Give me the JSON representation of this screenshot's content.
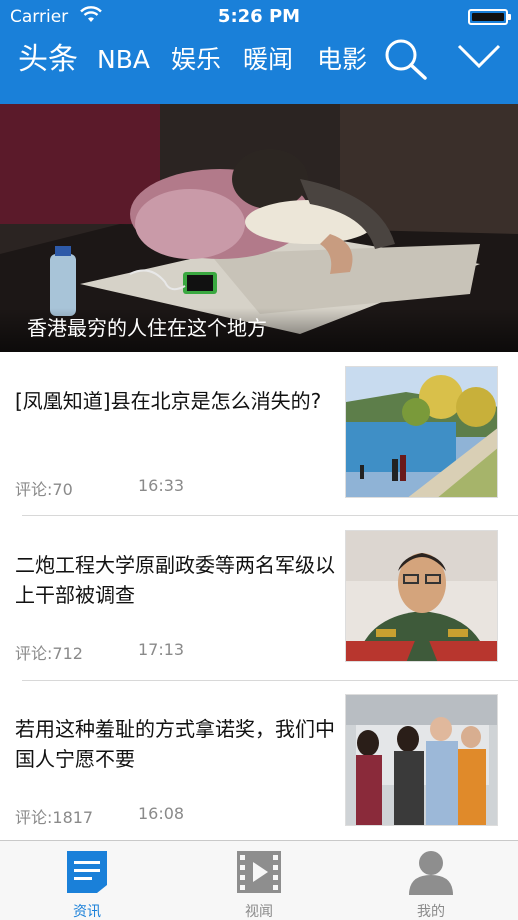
{
  "status_bar": {
    "carrier": "Carrier",
    "time": "5:26 PM"
  },
  "nav": {
    "tabs": [
      "头条",
      "NBA",
      "娱乐",
      "暖闻",
      "电影"
    ],
    "accent_color": "#1a80d9"
  },
  "hero": {
    "caption": "香港最穷的人住在这个地方"
  },
  "news": [
    {
      "title": "[凤凰知道]县在北京是怎么消失的?",
      "comments": "评论:70",
      "time": "16:33"
    },
    {
      "title": "二炮工程大学原副政委等两名军级以上干部被调查",
      "comments": "评论:712",
      "time": "17:13"
    },
    {
      "title": "若用这种羞耻的方式拿诺奖，我们中国人宁愿不要",
      "comments": "评论:1817",
      "time": "16:08"
    }
  ],
  "tabbar": {
    "items": [
      {
        "label": "资讯",
        "icon": "news-icon",
        "active": true
      },
      {
        "label": "视闻",
        "icon": "video-icon",
        "active": false
      },
      {
        "label": "我的",
        "icon": "profile-icon",
        "active": false
      }
    ]
  }
}
